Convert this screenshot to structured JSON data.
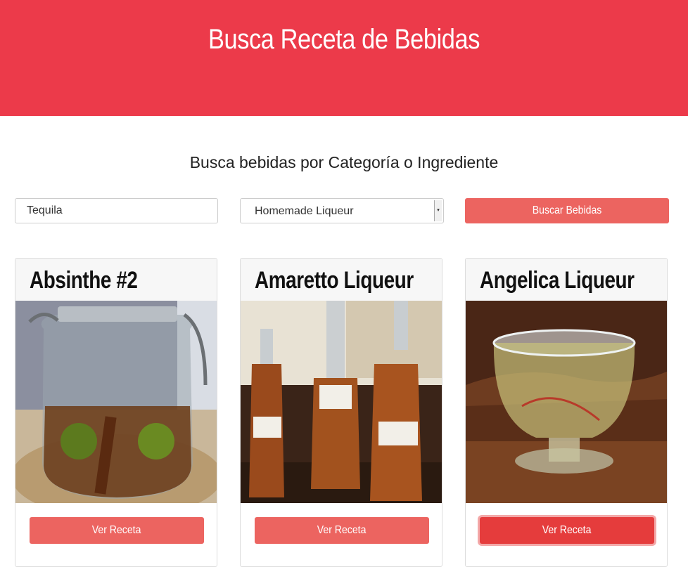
{
  "header": {
    "title": "Busca Receta de Bebidas"
  },
  "search": {
    "heading": "Busca bebidas por Categoría o Ingrediente",
    "ingredient_value": "Tequila",
    "category_selected": "Homemade Liqueur",
    "submit_label": "Buscar Bebidas"
  },
  "results": [
    {
      "name": "Absinthe #2",
      "button_label": "Ver Receta"
    },
    {
      "name": "Amaretto Liqueur",
      "button_label": "Ver Receta"
    },
    {
      "name": "Angelica Liqueur",
      "button_label": "Ver Receta"
    }
  ],
  "colors": {
    "header_bg": "#ec3a4a",
    "button_bg": "#ec6460",
    "button_active": "#e53c3c"
  }
}
